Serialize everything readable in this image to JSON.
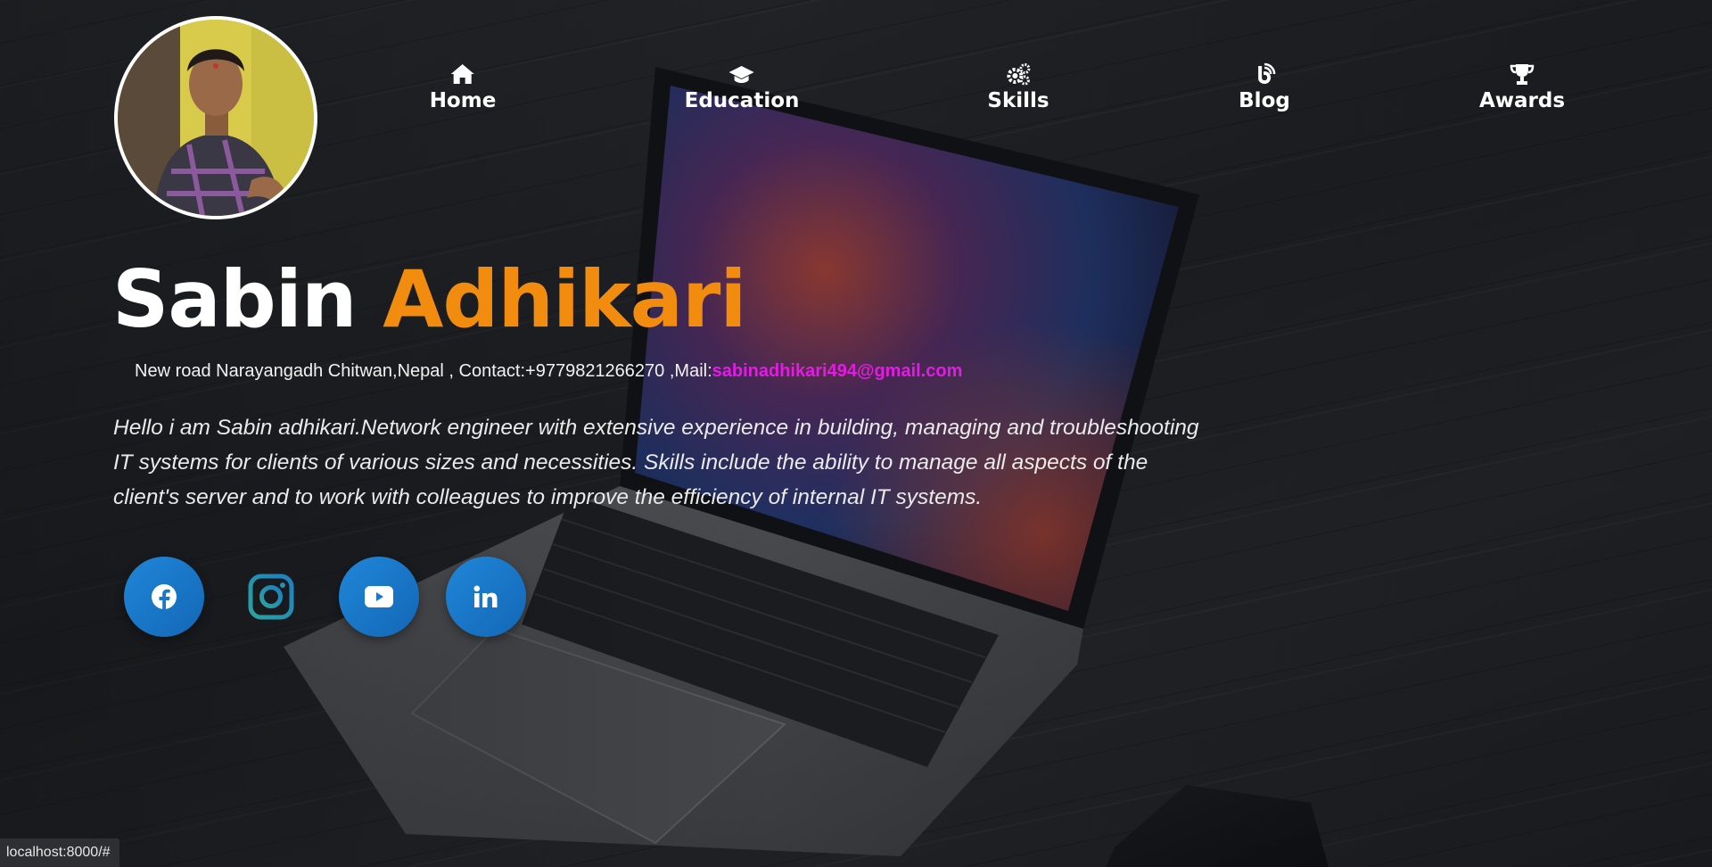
{
  "profile": {
    "avatar_label": "Profile photo"
  },
  "nav": {
    "items": [
      {
        "label": "Home",
        "icon": "home-icon"
      },
      {
        "label": "Education",
        "icon": "graduation-cap-icon"
      },
      {
        "label": "Skills",
        "icon": "gears-icon"
      },
      {
        "label": "Blog",
        "icon": "blog-icon"
      },
      {
        "label": "Awards",
        "icon": "trophy-icon"
      }
    ]
  },
  "hero": {
    "first_name": "Sabin",
    "last_name": "Adhikari",
    "contact_text": "New road Narayangadh Chitwan,Nepal , Contact:+9779821266270 ,Mail:",
    "email": "sabinadhikari494@gmail.com",
    "bio": "Hello i am Sabin adhikari.Network engineer with extensive experience in building, managing and troubleshooting IT systems for clients of various sizes and necessities. Skills include the ability to manage all aspects of the client's server and to work with colleagues to improve the efficiency of internal IT systems."
  },
  "social": [
    {
      "name": "facebook",
      "icon": "facebook-icon"
    },
    {
      "name": "instagram",
      "icon": "instagram-icon"
    },
    {
      "name": "youtube",
      "icon": "youtube-icon"
    },
    {
      "name": "linkedin",
      "icon": "linkedin-icon"
    }
  ],
  "colors": {
    "accent_orange": "#f28c0f",
    "email_magenta": "#e21ce2",
    "social_blue": "#1f86d8"
  },
  "status_bar": {
    "url": "localhost:8000/#"
  }
}
